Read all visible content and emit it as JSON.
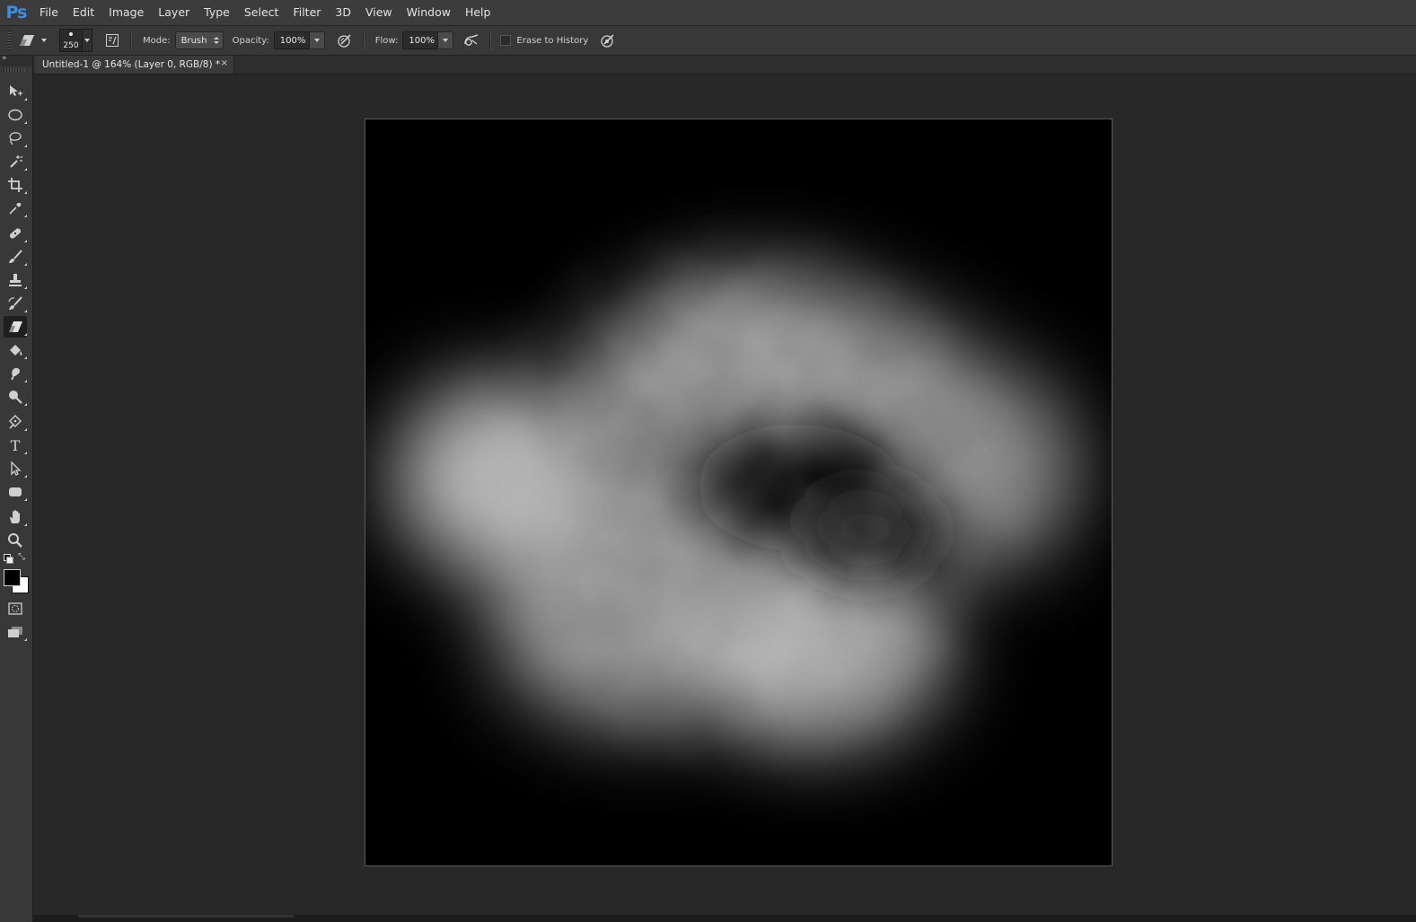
{
  "app": {
    "logo": "Ps"
  },
  "menu": [
    "File",
    "Edit",
    "Image",
    "Layer",
    "Type",
    "Select",
    "Filter",
    "3D",
    "View",
    "Window",
    "Help"
  ],
  "options": {
    "tool_icon": "eraser-icon",
    "brush_size": "250",
    "mode_label": "Mode:",
    "mode_value": "Brush",
    "opacity_label": "Opacity:",
    "opacity_value": "100%",
    "flow_label": "Flow:",
    "flow_value": "100%",
    "erase_to_history_label": "Erase to History",
    "erase_to_history_checked": false
  },
  "document_tab": {
    "title": "Untitled-1 @ 164% (Layer 0, RGB/8) *",
    "close": "×"
  },
  "toolbox": {
    "tools": [
      "move",
      "elliptical-marquee",
      "lasso",
      "magic-wand",
      "crop",
      "eyedropper",
      "spot-healing-brush",
      "brush",
      "clone-stamp",
      "history-brush",
      "eraser",
      "paint-bucket",
      "smudge",
      "dodge",
      "pen",
      "type",
      "path-selection",
      "rounded-rectangle",
      "hand",
      "zoom"
    ],
    "active_tool": "eraser",
    "type_tool_glyph": "T"
  },
  "colors": {
    "foreground": "#000000",
    "background": "#ffffff",
    "ui_dark": "#282828",
    "ui_panel": "#383838",
    "logo_blue": "#3d8ee0"
  }
}
